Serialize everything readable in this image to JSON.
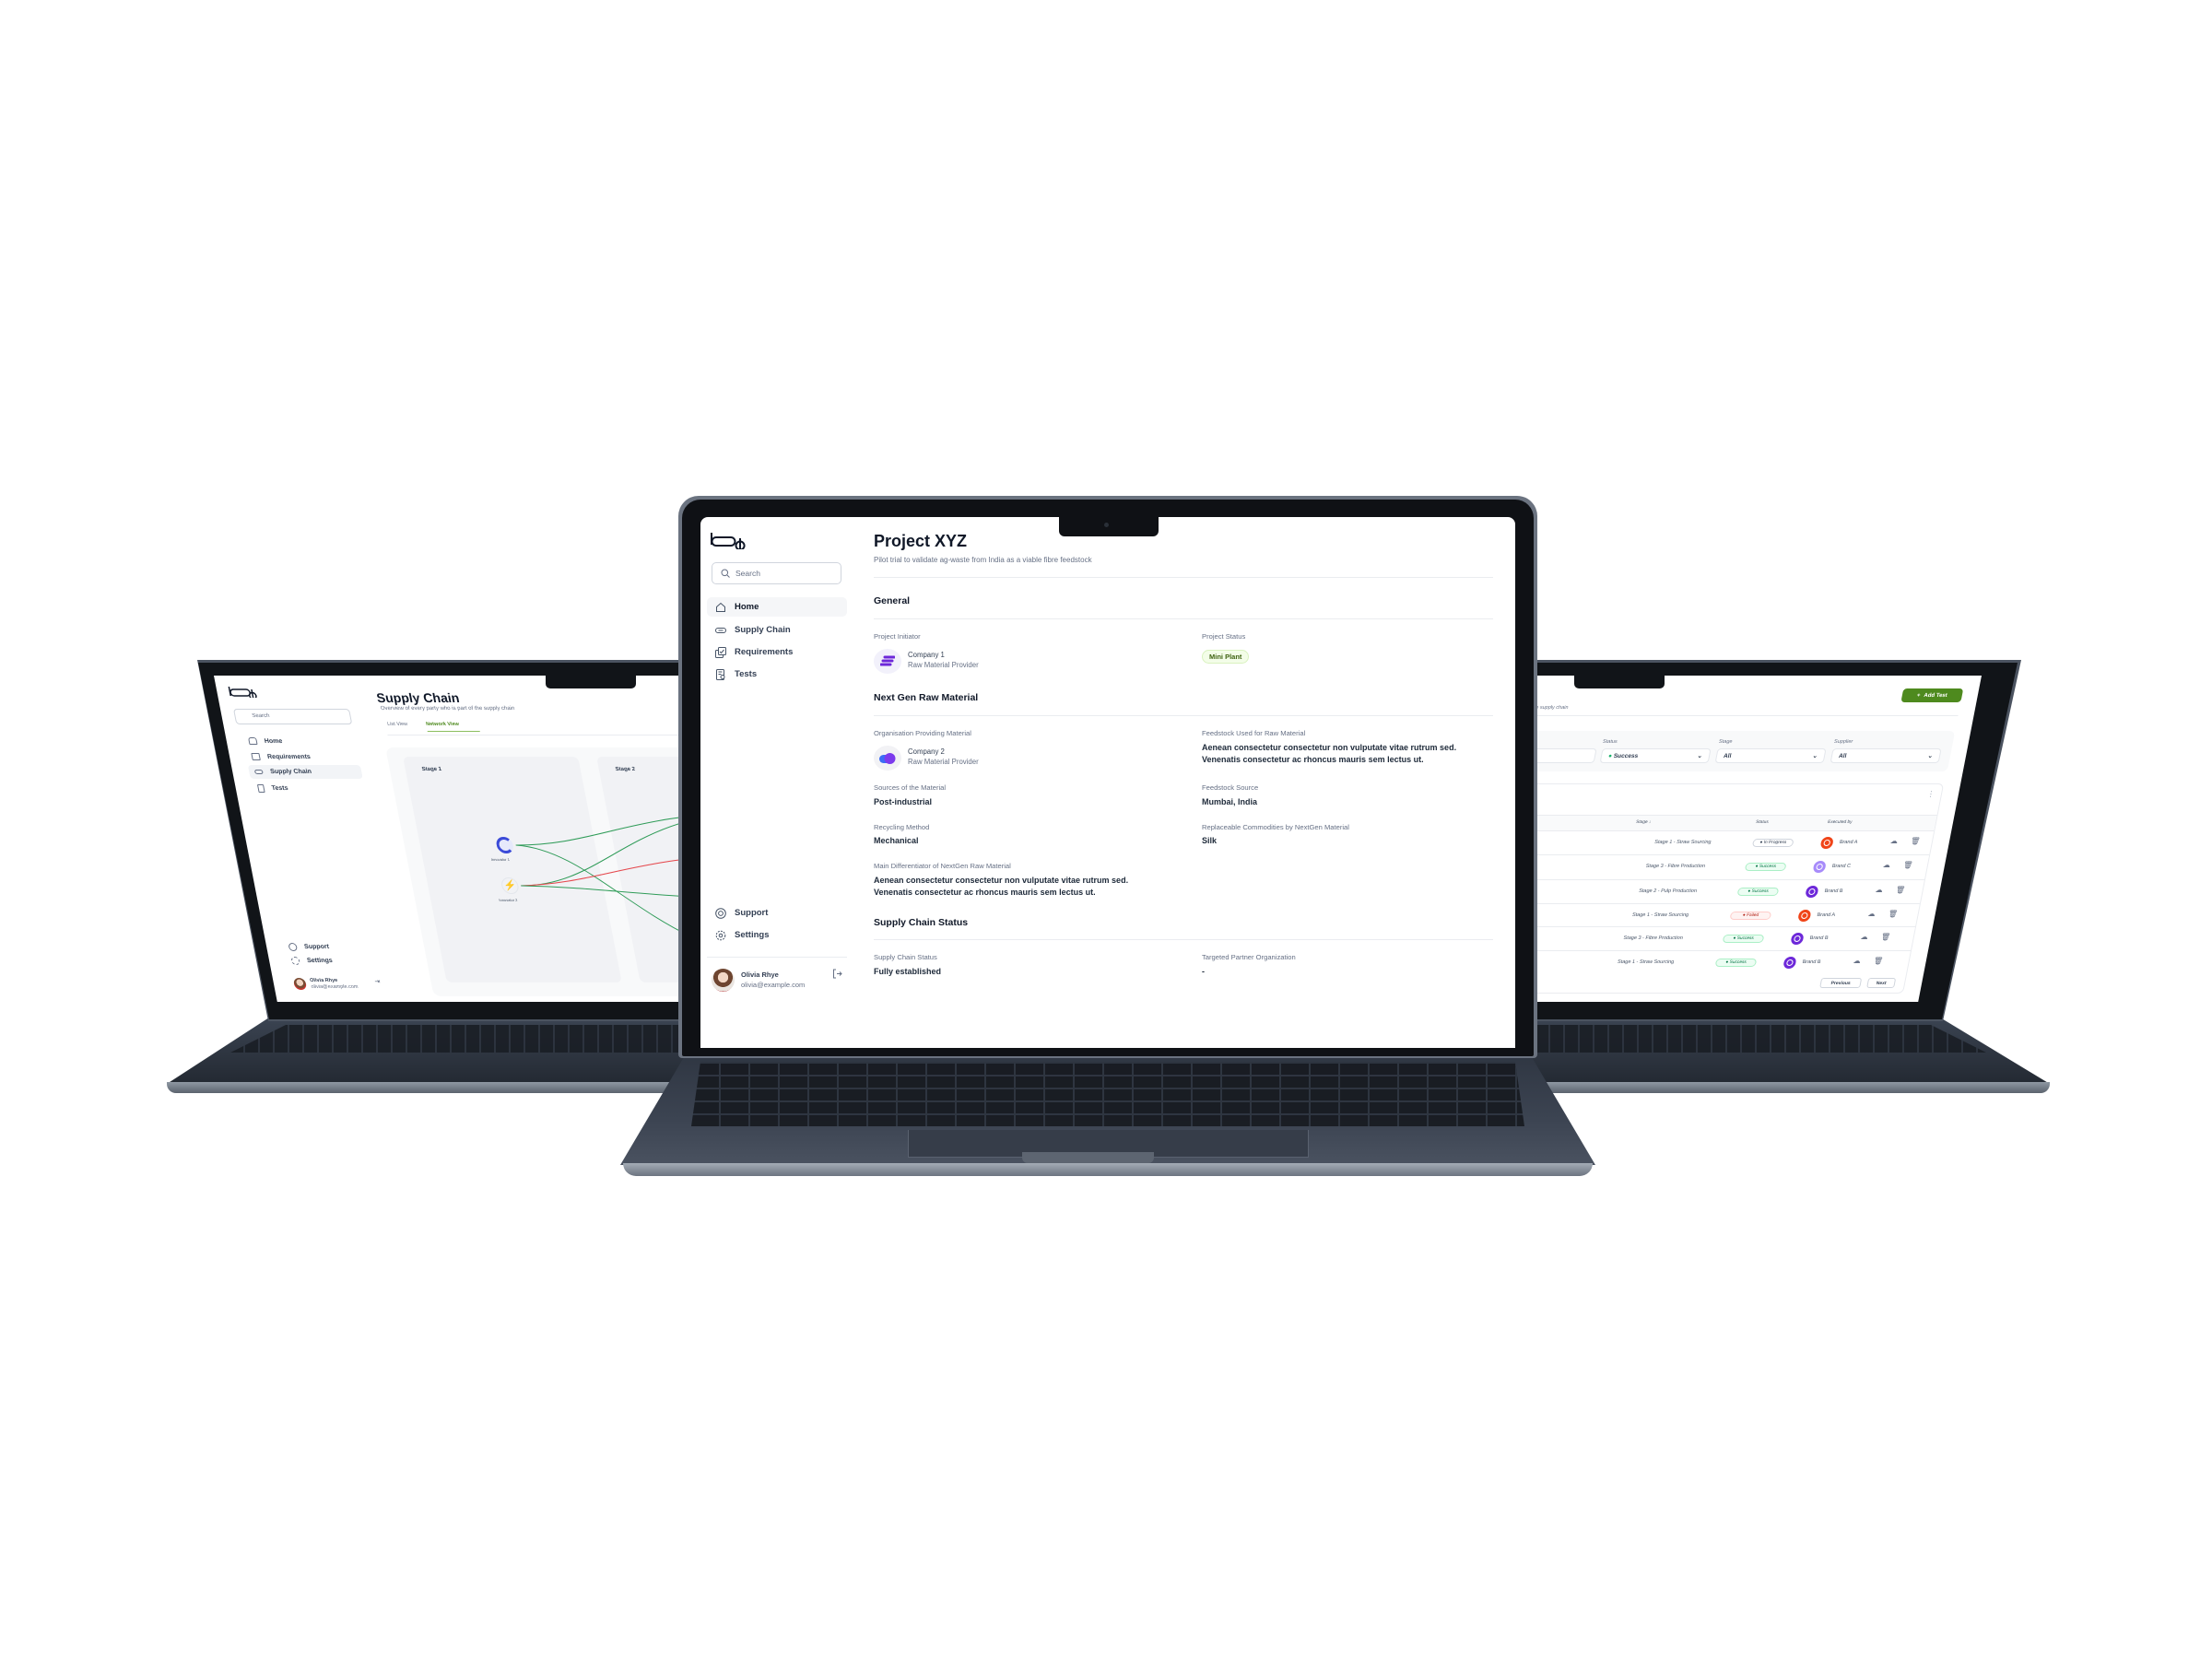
{
  "brand": {
    "logo_text": "loop"
  },
  "center_screen": {
    "sidebar": {
      "search_placeholder": "Search",
      "items": [
        {
          "label": "Home",
          "icon": "home-icon",
          "active": true
        },
        {
          "label": "Supply Chain",
          "icon": "link-icon"
        },
        {
          "label": "Requirements",
          "icon": "requirements-icon"
        },
        {
          "label": "Tests",
          "icon": "tests-icon"
        }
      ],
      "footer_items": [
        {
          "label": "Support",
          "icon": "lifebuoy-icon"
        },
        {
          "label": "Settings",
          "icon": "gear-icon"
        }
      ],
      "user": {
        "name": "Olivia Rhye",
        "email": "olivia@example.com"
      }
    },
    "header": {
      "title": "Project XYZ",
      "subtitle": "Pilot trial to validate ag-waste from India as a viable fibre feedstock"
    },
    "general": {
      "heading": "General",
      "initiator_label": "Project Initiator",
      "initiator_name": "Company 1",
      "initiator_role": "Raw Material Provider",
      "status_label": "Project Status",
      "status_value": "Mini Plant"
    },
    "material": {
      "heading": "Next Gen Raw Material",
      "org_label": "Organisation Providing Material",
      "org_name": "Company 2",
      "org_role": "Raw Material Provider",
      "feedstock_label": "Feedstock Used for Raw Material",
      "feedstock_value": "Aenean consectetur consectetur non vulputate vitae rutrum sed. Venenatis consectetur ac rhoncus mauris sem lectus ut.",
      "sources_label": "Sources of the Material",
      "sources_value": "Post-industrial",
      "feedstock_source_label": "Feedstock Source",
      "feedstock_source_value": "Mumbai, India",
      "recycling_label": "Recycling Method",
      "recycling_value": "Mechanical",
      "replaceable_label": "Replaceable Commodities by NextGen Material",
      "replaceable_value": "Silk",
      "differentiator_label": "Main Differentiator of NextGen Raw Material",
      "differentiator_value": "Aenean consectetur consectetur non vulputate vitae rutrum sed. Venenatis consectetur ac rhoncus mauris sem lectus ut."
    },
    "supply_chain": {
      "heading": "Supply Chain Status",
      "status_label": "Supply Chain Status",
      "status_value": "Fully established",
      "partner_label": "Targeted Partner Organization",
      "partner_value": "-"
    }
  },
  "left_screen": {
    "sidebar": {
      "search_placeholder": "Search",
      "items": [
        {
          "label": "Home"
        },
        {
          "label": "Requirements"
        },
        {
          "label": "Supply Chain",
          "active": true
        },
        {
          "label": "Tests"
        }
      ],
      "footer_items": [
        {
          "label": "Support"
        },
        {
          "label": "Settings"
        }
      ],
      "user": {
        "name": "Olivia Rhye",
        "email": "olivia@example.com"
      }
    },
    "header": {
      "title": "Supply Chain",
      "subtitle": "Overview of every party who is part of the supply chain"
    },
    "tabs": [
      {
        "label": "List View"
      },
      {
        "label": "Network View",
        "active": true
      }
    ],
    "stages": [
      "Stage 1",
      "Stage 2"
    ],
    "nodes": [
      {
        "label": "Innovator 1"
      },
      {
        "label": "Innovator 2"
      }
    ],
    "colors": {
      "accent": "#4e8a1e",
      "link_ok": "#2e9b57",
      "link_fail": "#e5484d"
    }
  },
  "right_screen": {
    "subtitle_fragment": "happens in the supply chain",
    "add_button": "Add Test",
    "filters": [
      {
        "label": "Status",
        "value": "Success"
      },
      {
        "label": "Stage",
        "value": "All"
      },
      {
        "label": "Supplier",
        "value": "All"
      }
    ],
    "columns": [
      "Stage",
      "Status",
      "Executed by"
    ],
    "rows": [
      {
        "stage": "Stage 1 - Straw Sourcing",
        "status": "In Progress",
        "brand": "Brand A"
      },
      {
        "stage": "Stage 3 - Fibre Production",
        "status": "Success",
        "brand": "Brand C"
      },
      {
        "stage": "Stage 2 - Pulp Production",
        "status": "Success",
        "brand": "Brand B"
      },
      {
        "stage": "Stage 1 - Straw Sourcing",
        "status": "Failed",
        "brand": "Brand A"
      },
      {
        "stage": "Stage 3 - Fibre Production",
        "status": "Success",
        "brand": "Brand B"
      },
      {
        "stage": "Stage 1 - Straw Sourcing",
        "status": "Success",
        "brand": "Brand B"
      }
    ],
    "pagination": {
      "previous": "Previous",
      "next": "Next"
    },
    "colors": {
      "accent": "#4e8a1e",
      "brand_a": "#f04418",
      "brand_b": "#6d28d9",
      "brand_c": "#a78bfa"
    }
  }
}
